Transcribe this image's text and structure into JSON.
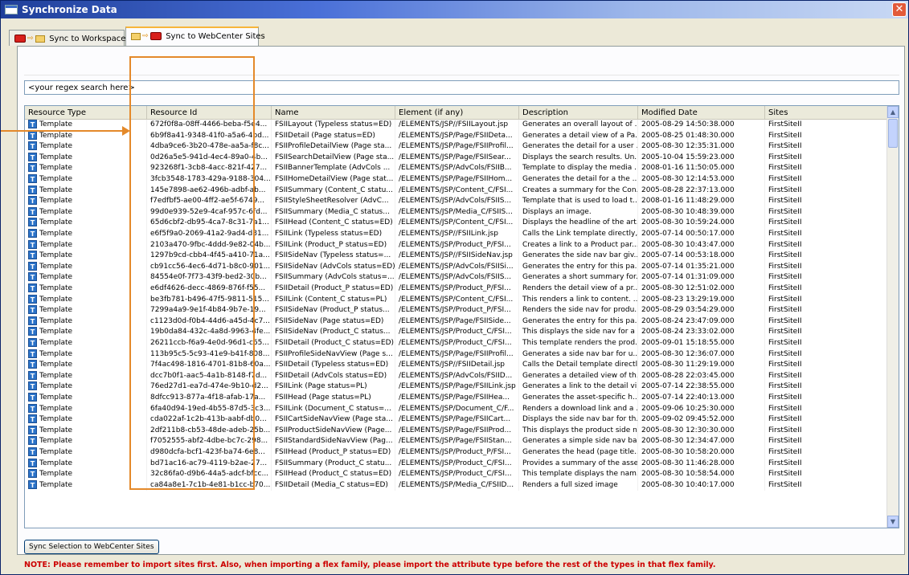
{
  "window": {
    "title": "Synchronize Data",
    "close_glyph": "✕"
  },
  "tabs": [
    {
      "label": "Sync to Workspace",
      "active": false
    },
    {
      "label": "Sync to WebCenter Sites",
      "active": true
    }
  ],
  "search": {
    "value": "<your regex search here>"
  },
  "table": {
    "columns": [
      "Resource Type",
      "Resource Id",
      "Name",
      "Element (if any)",
      "Description",
      "Modified Date",
      "Sites"
    ],
    "rows": [
      [
        "Template",
        "672f0f8a-08ff-4466-beba-f5e4...",
        "FSIILayout (Typeless status=ED)",
        "/ELEMENTS/JSP//FSIILayout.jsp",
        "Generates an overall layout of ...",
        "2005-08-29 14:50:38.000",
        "FirstSiteII"
      ],
      [
        "Template",
        "6b9f8a41-9348-41f0-a5a6-4bd...",
        "FSIIDetail (Page status=ED)",
        "/ELEMENTS/JSP/Page/FSIIDeta...",
        "Generates a detail view of a Pa...",
        "2005-08-25 01:48:30.000",
        "FirstSiteII"
      ],
      [
        "Template",
        "4dba9ce6-3b20-478e-aa5a-f8c...",
        "FSIIProfileDetailView (Page sta...",
        "/ELEMENTS/JSP/Page/FSIIProfil...",
        "Generates the detail for a user ...",
        "2005-08-30 12:35:31.000",
        "FirstSiteII"
      ],
      [
        "Template",
        "0d26a5e5-941d-4ec4-89a0-4b...",
        "FSIISearchDetailView (Page sta...",
        "/ELEMENTS/JSP/Page/FSIISear...",
        "Displays the search results. Un...",
        "2005-10-04 15:59:23.000",
        "FirstSiteII"
      ],
      [
        "Template",
        "923268f1-3cb8-4acc-821f-427...",
        "FSIIBannerTemplate (AdvCols ...",
        "/ELEMENTS/JSP/AdvCols/FSIIB...",
        "Template to display the media ...",
        "2008-01-16 11:50:05.000",
        "FirstSiteII"
      ],
      [
        "Template",
        "3fcb3548-1783-429a-9188-304...",
        "FSIIHomeDetailView (Page stat...",
        "/ELEMENTS/JSP/Page/FSIIHom...",
        "Generates the detail for a the ...",
        "2005-08-30 12:14:53.000",
        "FirstSiteII"
      ],
      [
        "Template",
        "145e7898-ae62-496b-adbf-ab...",
        "FSIISummary (Content_C statu...",
        "/ELEMENTS/JSP/Content_C/FSI...",
        "Creates a summary for the Con...",
        "2005-08-28 22:37:13.000",
        "FirstSiteII"
      ],
      [
        "Template",
        "f7edfbf5-ae00-4ff2-ae5f-6749...",
        "FSIIStyleSheetResolver (AdvC...",
        "/ELEMENTS/JSP/AdvCols/FSIIS...",
        "Template that is used to load t...",
        "2008-01-16 11:48:29.000",
        "FirstSiteII"
      ],
      [
        "Template",
        "99d0e939-52e9-4caf-957c-6fd...",
        "FSIISummary (Media_C status...",
        "/ELEMENTS/JSP/Media_C/FSIIS...",
        "Displays an image.",
        "2005-08-30 10:48:39.000",
        "FirstSiteII"
      ],
      [
        "Template",
        "65d6cbf2-db95-4ca7-8c31-7a1...",
        "FSIIHead (Content_C status=ED)",
        "/ELEMENTS/JSP/Content_C/FSI...",
        "Displays the headline of the art...",
        "2005-08-30 10:59:24.000",
        "FirstSiteII"
      ],
      [
        "Template",
        "e6f5f9a0-2069-41a2-9ad4-d81...",
        "FSIILink (Typeless status=ED)",
        "/ELEMENTS/JSP//FSIILink.jsp",
        "Calls the Link template directly,...",
        "2005-07-14 00:50:17.000",
        "FirstSiteII"
      ],
      [
        "Template",
        "2103a470-9fbc-4ddd-9e82-04b...",
        "FSIILink (Product_P status=ED)",
        "/ELEMENTS/JSP/Product_P/FSI...",
        "Creates a link to a Product par...",
        "2005-08-30 10:43:47.000",
        "FirstSiteII"
      ],
      [
        "Template",
        "1297b9cd-cbb4-4f45-a410-71a...",
        "FSIISideNav (Typeless status=...",
        "/ELEMENTS/JSP//FSIISideNav.jsp",
        "Generates the side nav bar giv...",
        "2005-07-14 00:53:18.000",
        "FirstSiteII"
      ],
      [
        "Template",
        "cb91cc56-4ec6-4d71-b8c0-901...",
        "FSIISideNav (AdvCols status=ED)",
        "/ELEMENTS/JSP/AdvCols/FSIISi...",
        "Generates the entry for this pa...",
        "2005-07-14 01:35:21.000",
        "FirstSiteII"
      ],
      [
        "Template",
        "84554e0f-7f73-43f9-bed2-30b...",
        "FSIISummary (AdvCols status=...",
        "/ELEMENTS/JSP/AdvCols/FSIIS...",
        "Generates a short summary for...",
        "2005-07-14 01:31:09.000",
        "FirstSiteII"
      ],
      [
        "Template",
        "e6df4626-decc-4869-876f-f55...",
        "FSIIDetail (Product_P status=ED)",
        "/ELEMENTS/JSP/Product_P/FSI...",
        "Renders the detail view of a pr...",
        "2005-08-30 12:51:02.000",
        "FirstSiteII"
      ],
      [
        "Template",
        "be3fb781-b496-47f5-9811-515...",
        "FSIILink (Content_C status=PL)",
        "/ELEMENTS/JSP/Content_C/FSI...",
        "This renders a link to content. ...",
        "2005-08-23 13:29:19.000",
        "FirstSiteII"
      ],
      [
        "Template",
        "7299a4a9-9e1f-4b84-9b7e-19...",
        "FSIISideNav (Product_P status...",
        "/ELEMENTS/JSP/Product_P/FSI...",
        "Renders the side nav for produ...",
        "2005-08-29 03:54:29.000",
        "FirstSiteII"
      ],
      [
        "Template",
        "c1123d0d-f0b4-44d6-a45d-4c7...",
        "FSIISideNav (Page status=ED)",
        "/ELEMENTS/JSP/Page/FSIISide...",
        "Generates the entry for this pa...",
        "2005-08-24 23:47:09.000",
        "FirstSiteII"
      ],
      [
        "Template",
        "19b0da84-432c-4a8d-9963-4fe...",
        "FSIISideNav (Product_C status...",
        "/ELEMENTS/JSP/Product_C/FSI...",
        "This displays the side nav for a ...",
        "2005-08-24 23:33:02.000",
        "FirstSiteII"
      ],
      [
        "Template",
        "26211ccb-f6a9-4e0d-96d1-c65...",
        "FSIIDetail (Product_C status=ED)",
        "/ELEMENTS/JSP/Product_C/FSI...",
        "This template renders the prod...",
        "2005-09-01 15:18:55.000",
        "FirstSiteII"
      ],
      [
        "Template",
        "113b95c5-5c93-41e9-b41f-808...",
        "FSIIProfileSideNavView (Page s...",
        "/ELEMENTS/JSP/Page/FSIIProfil...",
        "Generates a side nav bar for u...",
        "2005-08-30 12:36:07.000",
        "FirstSiteII"
      ],
      [
        "Template",
        "7f4ac498-1816-4701-81b8-60a...",
        "FSIIDetail (Typeless status=ED)",
        "/ELEMENTS/JSP//FSIIDetail.jsp",
        "Calls the Detail template directl...",
        "2005-08-30 11:29:19.000",
        "FirstSiteII"
      ],
      [
        "Template",
        "dcc7b0f1-aac5-4a1b-8148-f7d...",
        "FSIIDetail (AdvCols status=ED)",
        "/ELEMENTS/JSP/AdvCols/FSIID...",
        "Generates a detailed view of th...",
        "2005-08-28 22:03:45.000",
        "FirstSiteII"
      ],
      [
        "Template",
        "76ed27d1-ea7d-474e-9b10-d2...",
        "FSIILink (Page status=PL)",
        "/ELEMENTS/JSP/Page/FSIILink.jsp",
        "Generates a link to the detail vi...",
        "2005-07-14 22:38:55.000",
        "FirstSiteII"
      ],
      [
        "Template",
        "8dfcc913-877a-4f18-afab-17a...",
        "FSIIHead (Page status=PL)",
        "/ELEMENTS/JSP/Page/FSIIHea...",
        "Generates the asset-specific h...",
        "2005-07-14 22:40:13.000",
        "FirstSiteII"
      ],
      [
        "Template",
        "6fa40d94-19ed-4b55-87d5-3c3...",
        "FSIILink (Document_C status=...",
        "/ELEMENTS/JSP/Document_C/F...",
        "Renders a download link and a ...",
        "2005-09-06 10:25:30.000",
        "FirstSiteII"
      ],
      [
        "Template",
        "cda022af-1c2b-413b-aabf-db0...",
        "FSIICartSideNavView (Page sta...",
        "/ELEMENTS/JSP/Page/FSIICart...",
        "Displays the side nav bar for th...",
        "2005-09-02 09:45:52.000",
        "FirstSiteII"
      ],
      [
        "Template",
        "2df211b8-cb53-48de-adeb-25b...",
        "FSIIProductSideNavView (Page...",
        "/ELEMENTS/JSP/Page/FSIIProd...",
        "This displays the product side n...",
        "2005-08-30 12:30:30.000",
        "FirstSiteII"
      ],
      [
        "Template",
        "f7052555-abf2-4dbe-bc7c-298...",
        "FSIIStandardSideNavView (Pag...",
        "/ELEMENTS/JSP/Page/FSIIStan...",
        "Generates a simple side nav ba...",
        "2005-08-30 12:34:47.000",
        "FirstSiteII"
      ],
      [
        "Template",
        "d980dcfa-bcf1-423f-ba74-6e8...",
        "FSIIHead (Product_P status=ED)",
        "/ELEMENTS/JSP/Product_P/FSI...",
        "Generates the head (page title...",
        "2005-08-30 10:58:20.000",
        "FirstSiteII"
      ],
      [
        "Template",
        "bd71ac16-ac79-4119-b2ae-27...",
        "FSIISummary (Product_C statu...",
        "/ELEMENTS/JSP/Product_C/FSI...",
        "Provides a summary of the asset",
        "2005-08-30 11:46:28.000",
        "FirstSiteII"
      ],
      [
        "Template",
        "32c86fa0-d9b6-44a5-adcf-bfcc...",
        "FSIIHead (Product_C status=ED)",
        "/ELEMENTS/JSP/Product_C/FSI...",
        "This template displays the nam...",
        "2005-08-30 10:58:54.000",
        "FirstSiteII"
      ],
      [
        "Template",
        "ca84a8e1-7c1b-4e81-b1cc-b70...",
        "FSIIDetail (Media_C status=ED)",
        "/ELEMENTS/JSP/Media_C/FSIID...",
        "Renders a full sized image",
        "2005-08-30 10:40:17.000",
        "FirstSiteII"
      ]
    ]
  },
  "sync_button": {
    "label": "Sync Selection to WebCenter Sites"
  },
  "note": "NOTE: Please remember to import sites first. Also, when importing a flex family, please import the attribute type before the rest of the types in that flex family.",
  "colors": {
    "accent_highlight": "#e4892a",
    "note_red": "#cc0000",
    "title_blue": "#1f3f9a"
  },
  "icons": [
    "window-icon",
    "close-icon",
    "oracle-red-icon",
    "arrow-icon",
    "folder-icon",
    "template-icon",
    "scroll-up-icon",
    "scroll-down-icon"
  ]
}
